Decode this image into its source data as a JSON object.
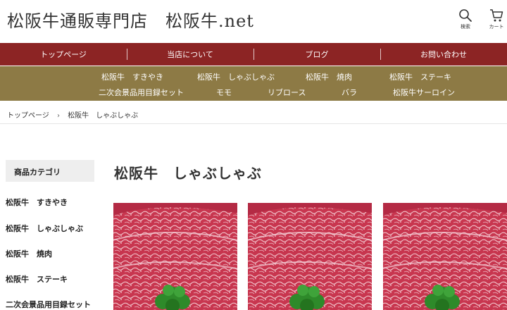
{
  "header": {
    "site_title": "松阪牛通販専門店　松阪牛.net",
    "search_label": "検索",
    "cart_label": "カート"
  },
  "nav": {
    "main": [
      "トップページ",
      "当店について",
      "ブログ",
      "お問い合わせ"
    ],
    "sub": {
      "sukiyaki": "松阪牛　すきやき",
      "shabu": "松阪牛　しゃぶしゃぶ",
      "yakiniku": "松阪牛　焼肉",
      "steak": "松阪牛　ステーキ",
      "gift": "二次会景品用目録セット",
      "momo": "モモ",
      "ribroast": "リブロース",
      "bara": "バラ",
      "sirloin": "松阪牛サーロイン"
    }
  },
  "breadcrumb": {
    "home": "トップページ",
    "separator": "›",
    "current": "松阪牛　しゃぶしゃぶ"
  },
  "sidebar": {
    "heading": "商品カテゴリ",
    "items": [
      "松阪牛　すきやき",
      "松阪牛　しゃぶしゃぶ",
      "松阪牛　焼肉",
      "松阪牛　ステーキ",
      "二次会景品用目録セット"
    ]
  },
  "main": {
    "title": "松阪牛　しゃぶしゃぶ"
  },
  "colors": {
    "nav_main_bg": "#8c2424",
    "nav_sub_bg": "#8d7a45",
    "sidebar_head_bg": "#eeeeee"
  }
}
